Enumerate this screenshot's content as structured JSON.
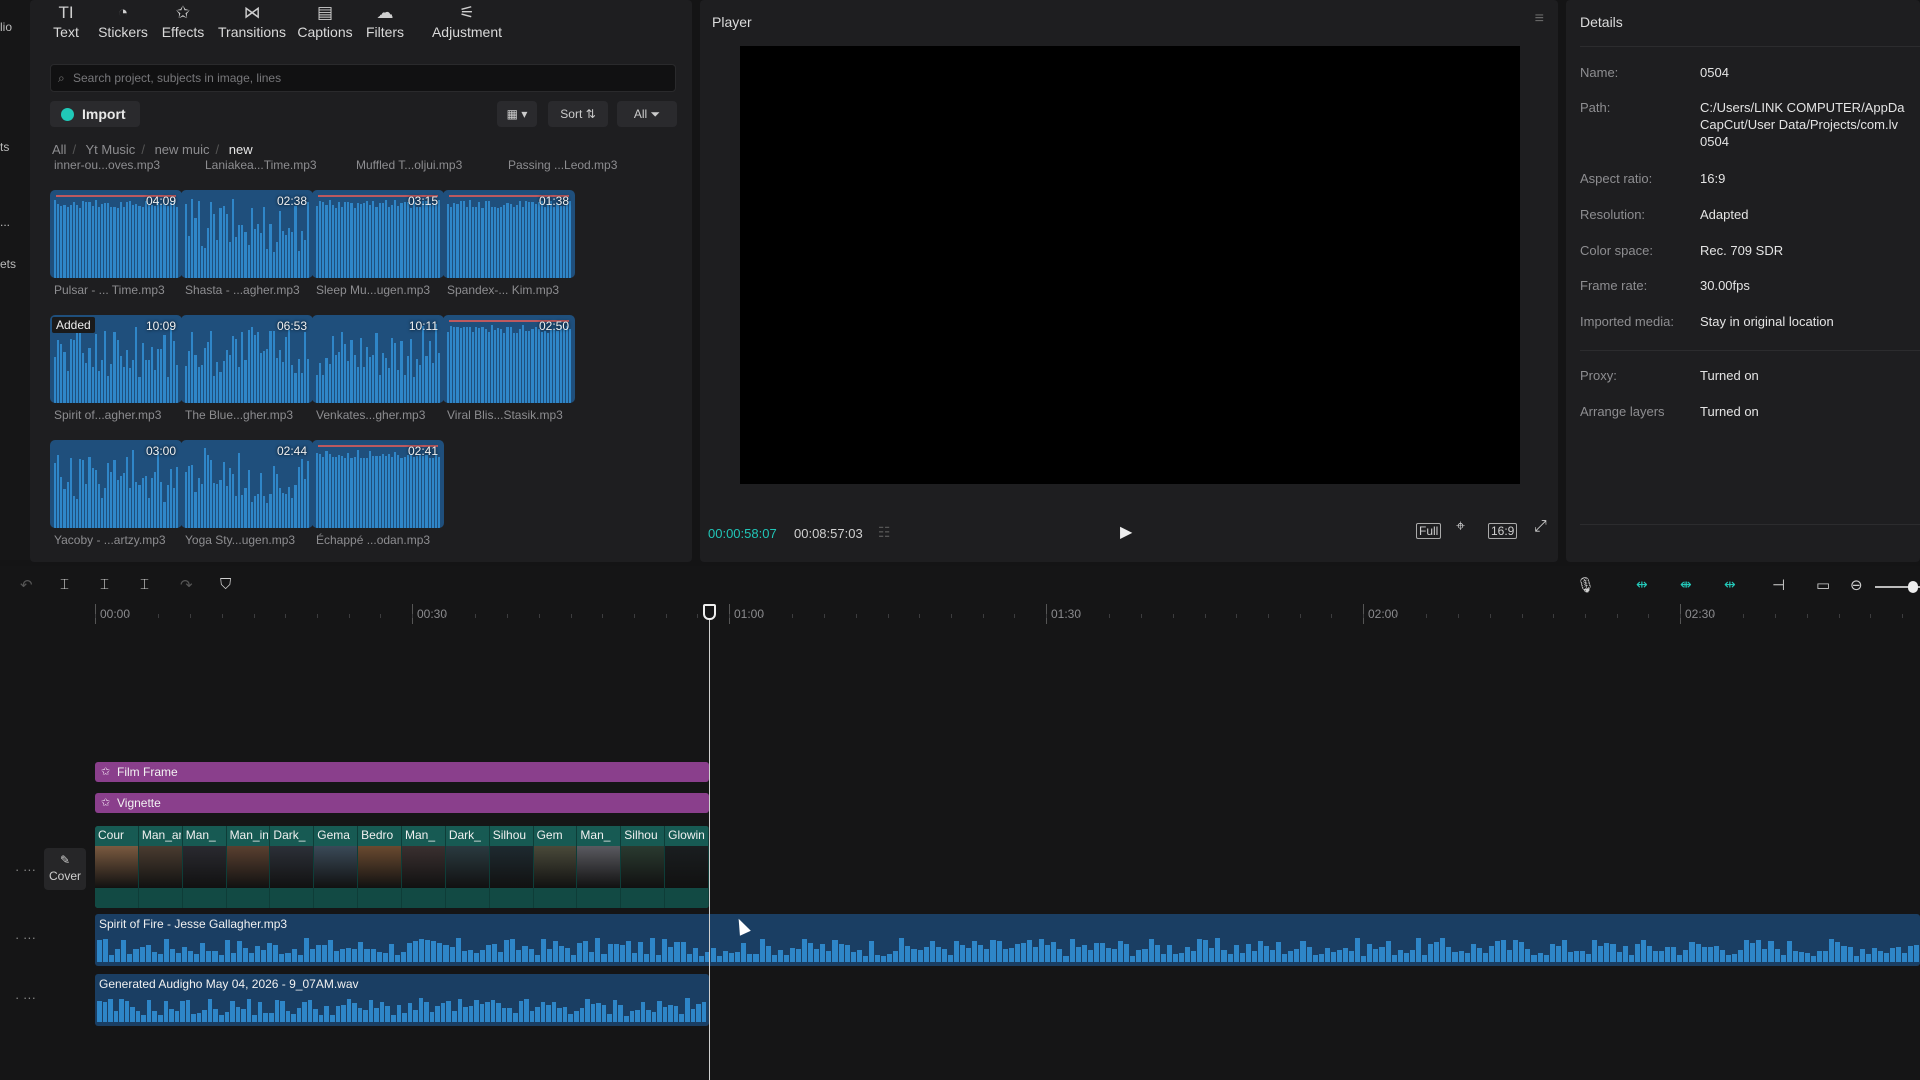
{
  "left_rail": {
    "items": [
      "lio",
      "ts",
      "...",
      "ets"
    ]
  },
  "toolbar": {
    "items": [
      {
        "label": "Text",
        "icon": "TI"
      },
      {
        "label": "Stickers",
        "icon": "◔"
      },
      {
        "label": "Effects",
        "icon": "✩"
      },
      {
        "label": "Transitions",
        "icon": "⋈"
      },
      {
        "label": "Captions",
        "icon": "▤"
      },
      {
        "label": "Filters",
        "icon": "☁"
      },
      {
        "label": "Adjustment",
        "icon": "⚟"
      }
    ]
  },
  "media": {
    "search_placeholder": "Search project, subjects in image, lines",
    "import_label": "Import",
    "view_label": "▦ ▾",
    "sort_label": "Sort ⇅",
    "all_label": "All ⏷",
    "breadcrumb": [
      "All",
      "Yt Music",
      "new muic",
      "new"
    ],
    "top_names": [
      "inner-ou...oves.mp3",
      "Laniakea...Time.mp3",
      "Muffled T...oljui.mp3",
      "Passing ...Leod.mp3"
    ],
    "tiles": [
      {
        "name": "Pulsar - ... Time.mp3",
        "duration": "04:09",
        "red": true
      },
      {
        "name": "Shasta - ...agher.mp3",
        "duration": "02:38",
        "red": false
      },
      {
        "name": "Sleep Mu...ugen.mp3",
        "duration": "03:15",
        "red": true
      },
      {
        "name": "Spandex-... Kim.mp3",
        "duration": "01:38",
        "red": true
      },
      {
        "name": "Spirit of...agher.mp3",
        "duration": "10:09",
        "red": false,
        "badge": "Added"
      },
      {
        "name": "The Blue...gher.mp3",
        "duration": "06:53",
        "red": false
      },
      {
        "name": "Venkates...gher.mp3",
        "duration": "10:11",
        "red": false
      },
      {
        "name": "Viral Blis...Stasik.mp3",
        "duration": "02:50",
        "red": true
      },
      {
        "name": "Yacoby - ...artzy.mp3",
        "duration": "03:00",
        "red": false
      },
      {
        "name": "Yoga Sty...ugen.mp3",
        "duration": "02:44",
        "red": false
      },
      {
        "name": "Échappé ...odan.mp3",
        "duration": "02:41",
        "red": true
      }
    ]
  },
  "player": {
    "title": "Player",
    "menu_icon": "≡",
    "current_time": "00:00:58:07",
    "total_time": "00:08:57:03",
    "list_icon": "☷",
    "play_icon": "▶",
    "full_label": "Full",
    "crop_icon": "⌖",
    "ratio_label": "16:9",
    "fullscreen_icon": "⤢"
  },
  "details": {
    "title": "Details",
    "rows": [
      {
        "label": "Name:",
        "value": "0504"
      },
      {
        "label": "Path:",
        "value_lines": [
          "C:/Users/LINK COMPUTER/AppDa",
          "CapCut/User Data/Projects/com.lv",
          "0504"
        ]
      },
      {
        "label": "Aspect ratio:",
        "value": "16:9"
      },
      {
        "label": "Resolution:",
        "value": "Adapted"
      },
      {
        "label": "Color space:",
        "value": "Rec. 709 SDR"
      },
      {
        "label": "Frame rate:",
        "value": "30.00fps"
      },
      {
        "label": "Imported media:",
        "value": "Stay in original location"
      },
      {
        "label": "Proxy:",
        "value": "Turned on"
      },
      {
        "label": "Arrange layers",
        "value": "Turned on"
      }
    ]
  },
  "timeline": {
    "ruler": [
      "00:00",
      "00:30",
      "01:00",
      "01:30",
      "02:00",
      "02:30"
    ],
    "fx_tracks": [
      "Film Frame",
      "Vignette"
    ],
    "cover_label": "Cover",
    "clips": [
      "Cour",
      "Man_ar",
      "Man_",
      "Man_in_bed",
      "Dark_",
      "Gema",
      "Bedro",
      "Man_",
      "Dark_",
      "Silhou",
      "Gem",
      "Man_",
      "Silhou",
      "Glowin"
    ],
    "audio_tracks": [
      "Spirit of Fire - Jesse Gallagher.mp3",
      "Generated Audigho May 04, 2026 - 9_07AM.wav"
    ]
  },
  "colors": {
    "accent": "#21c5b7",
    "fx_track": "#8a3f8c",
    "video_track": "#175a53",
    "audio_track": "#1a3e63",
    "wave": "#2e86c8"
  }
}
